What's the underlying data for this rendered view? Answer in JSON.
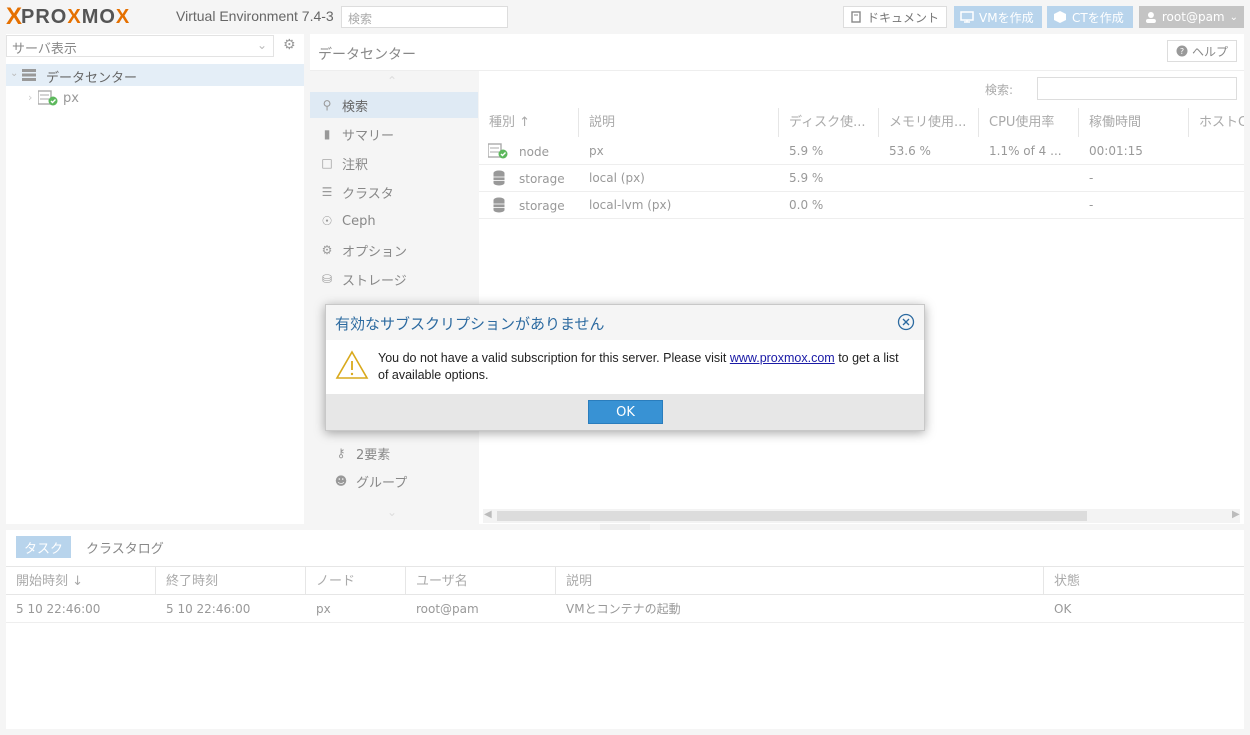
{
  "topbar": {
    "logo_x": "X",
    "logo_word_a": "PRO",
    "logo_word_b": "X",
    "logo_word_c": "MO",
    "logo_word_d": "X",
    "version": "Virtual Environment 7.4-3",
    "search_placeholder": "検索",
    "doc_button": "ドキュメント",
    "create_vm": "VMを作成",
    "create_ct": "CTを作成",
    "user": "root@pam"
  },
  "tree": {
    "view": "サーバ表示",
    "datacenter": "データセンター",
    "node": "px"
  },
  "main": {
    "title": "データセンター",
    "help": "ヘルプ",
    "search_label": "検索:"
  },
  "nav": {
    "items": [
      {
        "label": "検索",
        "icon": "search-icon"
      },
      {
        "label": "サマリー",
        "icon": "book-icon"
      },
      {
        "label": "注釈",
        "icon": "note-icon"
      },
      {
        "label": "クラスタ",
        "icon": "server-icon"
      },
      {
        "label": "Ceph",
        "icon": "ceph-icon"
      },
      {
        "label": "オプション",
        "icon": "gear-icon"
      },
      {
        "label": "ストレージ",
        "icon": "database-icon"
      },
      {
        "label": "2要素",
        "icon": "key-icon"
      },
      {
        "label": "グループ",
        "icon": "users-icon"
      }
    ]
  },
  "grid": {
    "columns": [
      "種別 ↑",
      "説明",
      "ディスク使...",
      "メモリ使用...",
      "CPU使用率",
      "稼働時間",
      "ホストC"
    ],
    "rows": [
      {
        "type": "node",
        "desc": "px",
        "disk": "5.9 %",
        "mem": "53.6 %",
        "cpu": "1.1% of 4 ...",
        "uptime": "00:01:15"
      },
      {
        "type": "storage",
        "desc": "local (px)",
        "disk": "5.9 %",
        "mem": "",
        "cpu": "",
        "uptime": "-"
      },
      {
        "type": "storage",
        "desc": "local-lvm (px)",
        "disk": "0.0 %",
        "mem": "",
        "cpu": "",
        "uptime": "-"
      }
    ]
  },
  "bottom": {
    "tabs": [
      "タスク",
      "クラスタログ"
    ],
    "columns": [
      "開始時刻 ↓",
      "終了時刻",
      "ノード",
      "ユーザ名",
      "説明",
      "状態"
    ],
    "rows": [
      {
        "start": "5 10 22:46:00",
        "end": "5 10 22:46:00",
        "node": "px",
        "user": "root@pam",
        "desc": "VMとコンテナの起動",
        "status": "OK"
      }
    ]
  },
  "dialog": {
    "title": "有効なサブスクリプションがありません",
    "msg_a": "You do not have a valid subscription for this server. Please visit ",
    "link": "www.proxmox.com",
    "msg_b": " to get a list of available options.",
    "ok": "OK"
  },
  "colors": {
    "accent": "#3892d4",
    "brand_orange": "#e57000",
    "selected_bg": "#dfeaf4"
  }
}
